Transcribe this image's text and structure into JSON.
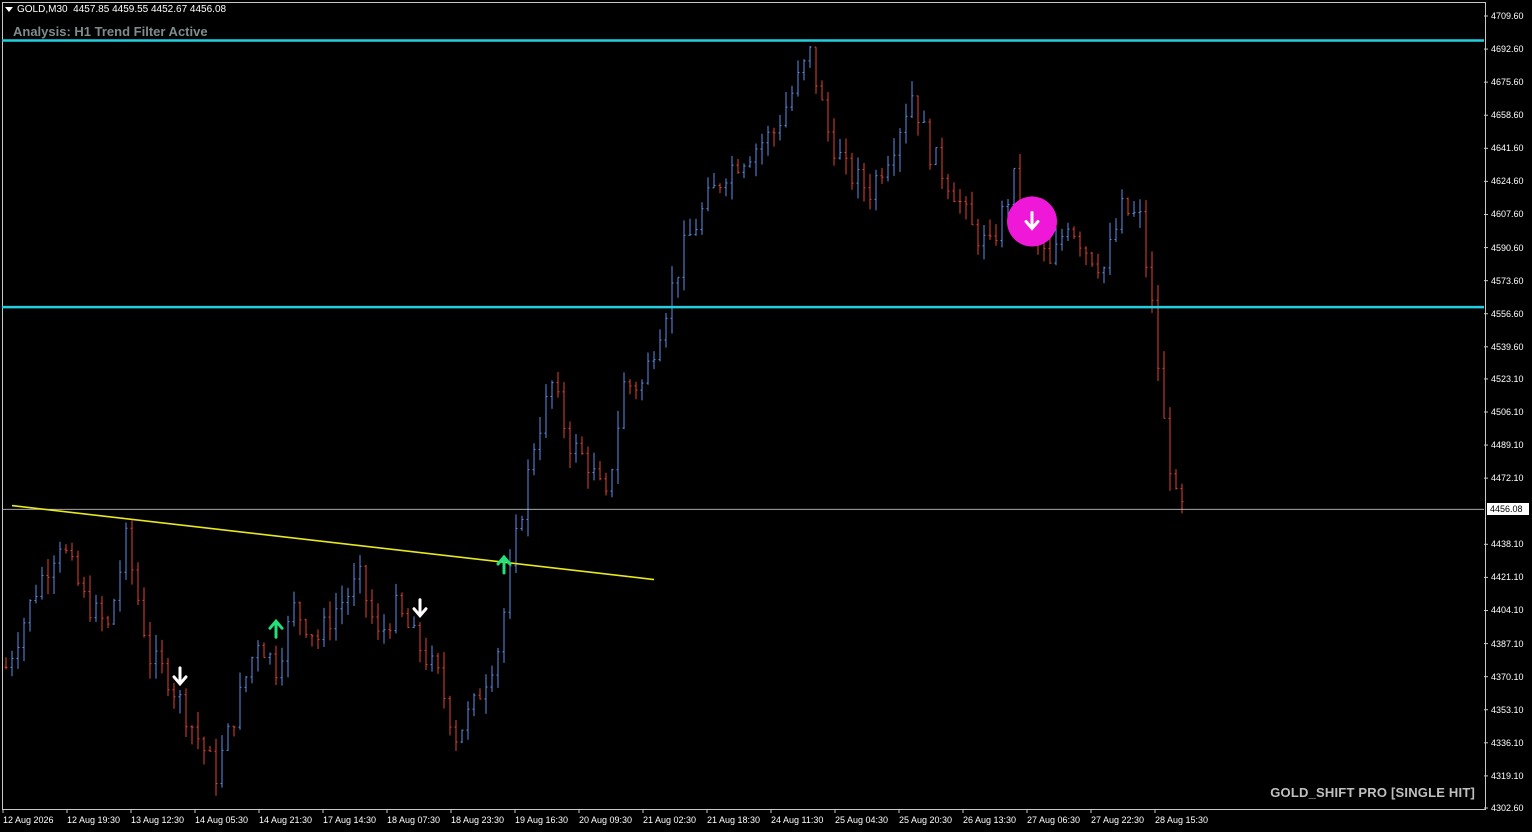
{
  "header": {
    "symbol": "GOLD,M30",
    "ohlc": "4457.85 4459.55 4452.67 4456.08"
  },
  "analysis_label": "Analysis: H1 Trend Filter Active",
  "watermark": "GOLD_SHIFT PRO [SINGLE HIT]",
  "current_price": "4456.08",
  "colors": {
    "background": "#000000",
    "bull_bar": "#5b8ee6",
    "bear_bar": "#e0452f",
    "level_line": "#20d0e0",
    "trend_line": "#e8e820",
    "up_arrow": "#22e07a",
    "down_arrow": "#ffffff",
    "signal_circle": "#f018d8"
  },
  "price_axis": [
    "4709.60",
    "4692.60",
    "4675.60",
    "4658.60",
    "4641.60",
    "4624.60",
    "4607.60",
    "4590.60",
    "4573.60",
    "4556.60",
    "4539.60",
    "4523.10",
    "4506.10",
    "4489.10",
    "4472.10",
    "4456.08",
    "4438.10",
    "4421.10",
    "4404.10",
    "4387.10",
    "4370.10",
    "4353.10",
    "4336.10",
    "4319.10",
    "4302.60"
  ],
  "time_axis": [
    "12 Aug 2026",
    "12 Aug 19:30",
    "13 Aug 12:30",
    "14 Aug 05:30",
    "14 Aug 21:30",
    "17 Aug 14:30",
    "18 Aug 07:30",
    "18 Aug 23:30",
    "19 Aug 16:30",
    "20 Aug 09:30",
    "21 Aug 02:30",
    "21 Aug 18:30",
    "24 Aug 11:30",
    "25 Aug 04:30",
    "25 Aug 20:30",
    "26 Aug 13:30",
    "27 Aug 06:30",
    "27 Aug 22:30",
    "28 Aug 15:30"
  ],
  "chart_data": {
    "type": "candlestick",
    "ylim": [
      4302.6,
      4709.6
    ],
    "levels": [
      4697.0,
      4560.0
    ],
    "current_price": 4456.08,
    "trend_line": {
      "from": [
        0,
        4458.0
      ],
      "to": [
        108,
        4420.0
      ]
    },
    "path_points": [
      [
        0,
        4375
      ],
      [
        5,
        4415
      ],
      [
        9,
        4440
      ],
      [
        13,
        4410
      ],
      [
        17,
        4395
      ],
      [
        20,
        4440
      ],
      [
        24,
        4380
      ],
      [
        27,
        4370
      ],
      [
        31,
        4345
      ],
      [
        35,
        4320
      ],
      [
        38,
        4350
      ],
      [
        42,
        4390
      ],
      [
        45,
        4375
      ],
      [
        48,
        4405
      ],
      [
        52,
        4390
      ],
      [
        55,
        4405
      ],
      [
        59,
        4420
      ],
      [
        62,
        4390
      ],
      [
        65,
        4405
      ],
      [
        69,
        4385
      ],
      [
        72,
        4370
      ],
      [
        75,
        4340
      ],
      [
        78,
        4355
      ],
      [
        82,
        4385
      ],
      [
        85,
        4440
      ],
      [
        88,
        4490
      ],
      [
        91,
        4520
      ],
      [
        94,
        4490
      ],
      [
        97,
        4480
      ],
      [
        100,
        4460
      ],
      [
        103,
        4520
      ],
      [
        106,
        4520
      ],
      [
        110,
        4560
      ],
      [
        113,
        4590
      ],
      [
        117,
        4615
      ],
      [
        120,
        4630
      ],
      [
        124,
        4640
      ],
      [
        128,
        4650
      ],
      [
        131,
        4670
      ],
      [
        134,
        4690
      ],
      [
        137,
        4650
      ],
      [
        140,
        4630
      ],
      [
        144,
        4620
      ],
      [
        148,
        4645
      ],
      [
        151,
        4670
      ],
      [
        154,
        4640
      ],
      [
        158,
        4620
      ],
      [
        161,
        4600
      ],
      [
        164,
        4590
      ],
      [
        168,
        4625
      ],
      [
        171,
        4600
      ],
      [
        174,
        4580
      ],
      [
        177,
        4605
      ],
      [
        180,
        4590
      ],
      [
        183,
        4580
      ],
      [
        186,
        4610
      ],
      [
        189,
        4605
      ],
      [
        191,
        4560
      ],
      [
        193,
        4500
      ],
      [
        195,
        4460
      ],
      [
        196,
        4456
      ]
    ],
    "bar_count": 197,
    "arrows": [
      {
        "index": 29,
        "price": 4370,
        "direction": "down"
      },
      {
        "index": 45,
        "price": 4395,
        "direction": "up"
      },
      {
        "index": 69,
        "price": 4405,
        "direction": "down"
      },
      {
        "index": 83,
        "price": 4428,
        "direction": "up"
      },
      {
        "index": 171,
        "price": 4604,
        "direction": "down",
        "highlight": true
      }
    ]
  }
}
